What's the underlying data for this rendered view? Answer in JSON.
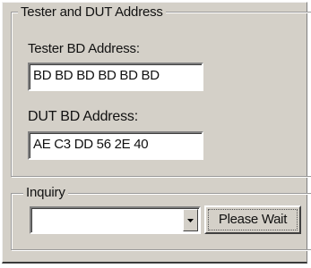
{
  "address_group": {
    "title": "Tester and DUT Address",
    "tester_label": "Tester BD Address:",
    "tester_value": "BD BD BD BD BD BD",
    "dut_label": "DUT BD Address:",
    "dut_value": "AE C3 DD 56 2E 40"
  },
  "inquiry_group": {
    "title": "Inquiry",
    "combo_value": "",
    "button_label": "Please Wait"
  }
}
